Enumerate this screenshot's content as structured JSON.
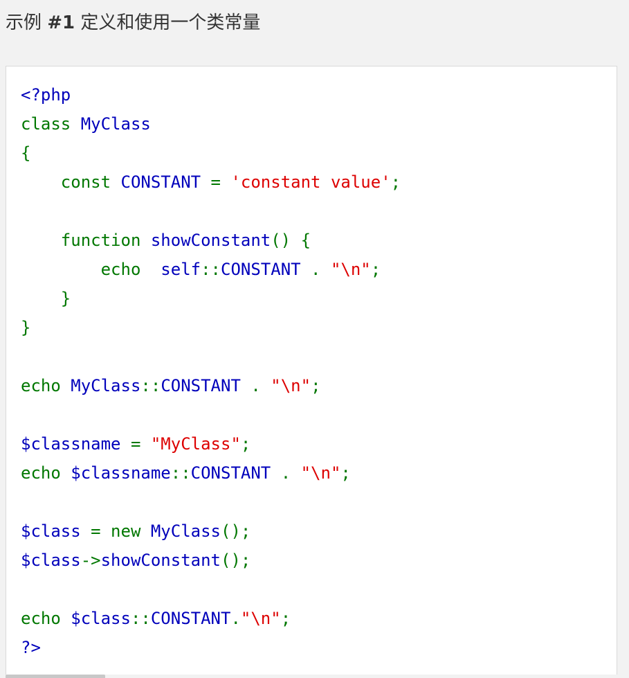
{
  "example": {
    "prefix": "示例 ",
    "number": "#1",
    "title": " 定义和使用一个类常量"
  },
  "code": {
    "language": "php",
    "colors": {
      "default": "#0000bb",
      "keyword": "#007700",
      "string": "#dd0000"
    },
    "lines": [
      [
        [
          "default",
          "<?php"
        ]
      ],
      [
        [
          "keyword",
          "class "
        ],
        [
          "default",
          "MyClass"
        ]
      ],
      [
        [
          "keyword",
          "{"
        ]
      ],
      [
        [
          "keyword",
          "    const "
        ],
        [
          "default",
          "CONSTANT "
        ],
        [
          "keyword",
          "= "
        ],
        [
          "string",
          "'constant value'"
        ],
        [
          "keyword",
          ";"
        ]
      ],
      [],
      [
        [
          "keyword",
          "    function "
        ],
        [
          "default",
          "showConstant"
        ],
        [
          "keyword",
          "() {"
        ]
      ],
      [
        [
          "keyword",
          "        echo  "
        ],
        [
          "default",
          "self"
        ],
        [
          "keyword",
          "::"
        ],
        [
          "default",
          "CONSTANT "
        ],
        [
          "keyword",
          ". "
        ],
        [
          "string",
          "\"\\n\""
        ],
        [
          "keyword",
          ";"
        ]
      ],
      [
        [
          "keyword",
          "    }"
        ]
      ],
      [
        [
          "keyword",
          "}"
        ]
      ],
      [],
      [
        [
          "keyword",
          "echo "
        ],
        [
          "default",
          "MyClass"
        ],
        [
          "keyword",
          "::"
        ],
        [
          "default",
          "CONSTANT "
        ],
        [
          "keyword",
          ". "
        ],
        [
          "string",
          "\"\\n\""
        ],
        [
          "keyword",
          ";"
        ]
      ],
      [],
      [
        [
          "default",
          "$classname "
        ],
        [
          "keyword",
          "= "
        ],
        [
          "string",
          "\"MyClass\""
        ],
        [
          "keyword",
          ";"
        ]
      ],
      [
        [
          "keyword",
          "echo "
        ],
        [
          "default",
          "$classname"
        ],
        [
          "keyword",
          "::"
        ],
        [
          "default",
          "CONSTANT "
        ],
        [
          "keyword",
          ". "
        ],
        [
          "string",
          "\"\\n\""
        ],
        [
          "keyword",
          ";"
        ]
      ],
      [],
      [
        [
          "default",
          "$class "
        ],
        [
          "keyword",
          "= new "
        ],
        [
          "default",
          "MyClass"
        ],
        [
          "keyword",
          "();"
        ]
      ],
      [
        [
          "default",
          "$class"
        ],
        [
          "keyword",
          "->"
        ],
        [
          "default",
          "showConstant"
        ],
        [
          "keyword",
          "();"
        ]
      ],
      [],
      [
        [
          "keyword",
          "echo "
        ],
        [
          "default",
          "$class"
        ],
        [
          "keyword",
          "::"
        ],
        [
          "default",
          "CONSTANT"
        ],
        [
          "keyword",
          "."
        ],
        [
          "string",
          "\"\\n\""
        ],
        [
          "keyword",
          ";"
        ]
      ],
      [
        [
          "default",
          "?>"
        ]
      ]
    ]
  }
}
